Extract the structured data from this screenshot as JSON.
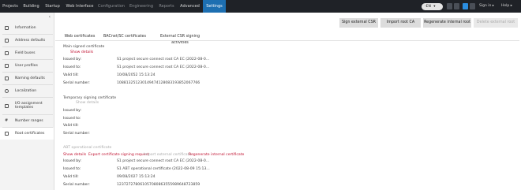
{
  "nav": {
    "items": [
      {
        "label": "Projects"
      },
      {
        "label": "Building"
      },
      {
        "label": "Startup"
      },
      {
        "label": "Web Interface"
      },
      {
        "label": "Configuration"
      },
      {
        "label": "Engineering"
      },
      {
        "label": "Reports"
      },
      {
        "label": "Advanced"
      },
      {
        "label": "Settings"
      }
    ],
    "language": "-EN",
    "signin": "Sign in",
    "help": "Help",
    "accent": "#1d6fb1"
  },
  "sidebar": {
    "items": [
      {
        "label": "Information",
        "icon": "info-icon"
      },
      {
        "label": "Address defaults",
        "icon": "address-icon"
      },
      {
        "label": "Field buses",
        "icon": "bus-icon"
      },
      {
        "label": "User profiles",
        "icon": "user-icon"
      },
      {
        "label": "Naming defaults",
        "icon": "naming-icon"
      },
      {
        "label": "Localization",
        "icon": "globe-icon"
      },
      {
        "label": "I/O assignment",
        "label2": "templates",
        "icon": "io-icon"
      },
      {
        "label": "Number ranges",
        "icon": "hash-icon"
      },
      {
        "label": "Root certificates",
        "icon": "certificate-icon"
      }
    ]
  },
  "toolbar": {
    "sign_csr": "Sign external CSR",
    "import_root": "Import root CA",
    "regenerate_root": "Regenerate internal root",
    "delete_disabled": "Delete external root"
  },
  "tabs": [
    {
      "label": "Web certificates"
    },
    {
      "label": "BACnet/SC certificates"
    },
    {
      "label": "External CSR signing activities"
    }
  ],
  "main_signed": {
    "heading": "Main signed certificate",
    "show_details": "Show details",
    "fields": [
      {
        "key": "Issued by:",
        "value": "S1 project secure connect root CA EC (2022-08-0..."
      },
      {
        "key": "Issued to:",
        "value": "S1 project secure connect root CA EC (2022-08-0..."
      },
      {
        "key": "Valid till:",
        "value": "10/08/2052 15:13:24"
      },
      {
        "key": "Serial number:",
        "value": "108813251230149474128083193852067766"
      }
    ]
  },
  "temporary": {
    "heading": "Temporary signing certificate",
    "show_details": "Show details",
    "fields": [
      {
        "key": "Issued by:"
      },
      {
        "key": "Issued to:"
      },
      {
        "key": "Valid till:"
      },
      {
        "key": "Serial number:"
      }
    ]
  },
  "abt": {
    "heading": "ABT operational certificate",
    "actions": {
      "show_details": "Show details",
      "export_csr": "Export certificate signing request",
      "import_external": "Import external certificate",
      "regenerate_internal": "Regenerate internal certificate"
    },
    "fields": [
      {
        "key": "Issued by:",
        "value": "S1 project secure connect root CA EC (2022-08-0..."
      },
      {
        "key": "Issued to:",
        "value": "S1 ABT operational certificate (2022-08-09 15:13..."
      },
      {
        "key": "Valid till:",
        "value": "09/08/2027 15:13:24"
      },
      {
        "key": "Serial number:",
        "value": "123727278061057080863555989648723859"
      }
    ]
  }
}
